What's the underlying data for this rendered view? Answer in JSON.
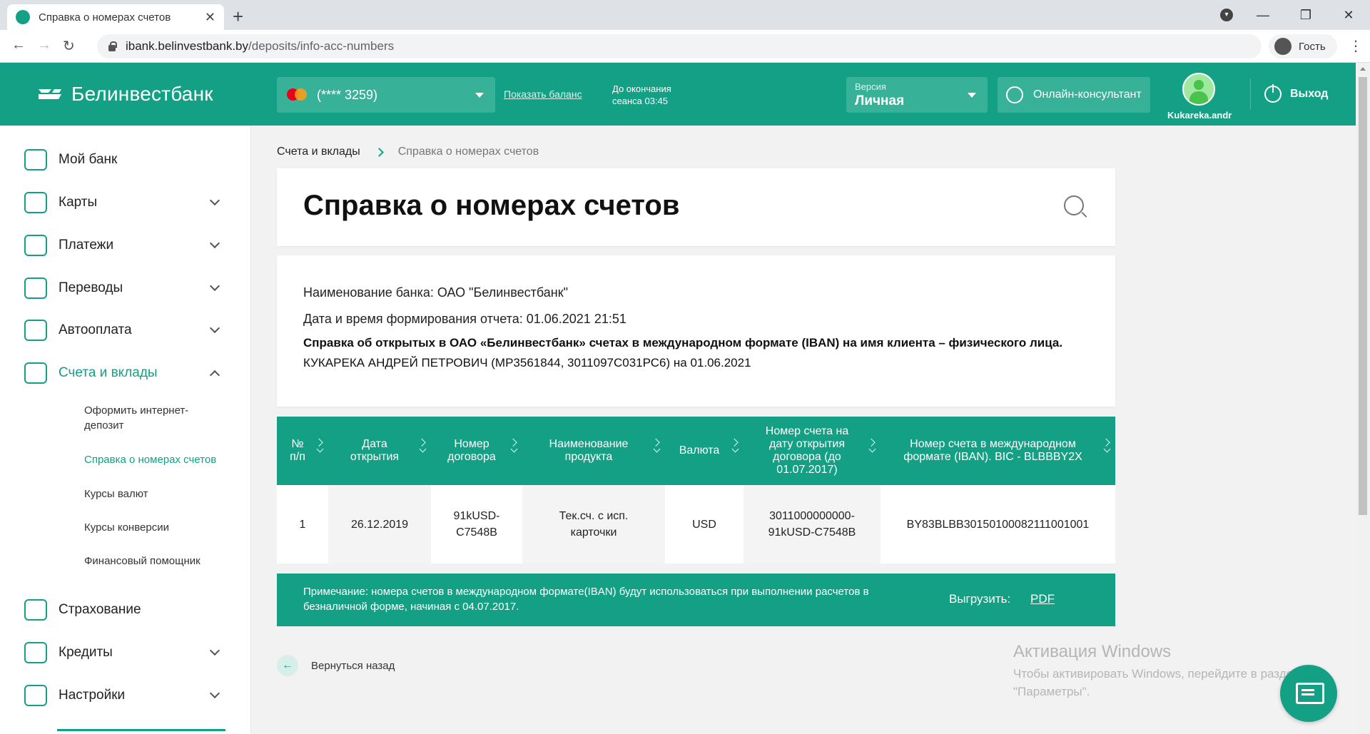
{
  "browser": {
    "tab_title": "Справка о номерах счетов",
    "url_host": "ibank.belinvestbank.by",
    "url_path": "/deposits/info-acc-numbers",
    "profile": "Гость"
  },
  "header": {
    "logo": "Белинвестбанк",
    "card": "(**** 3259)",
    "show_balance": "Показать баланс",
    "session_line1": "До окончания",
    "session_line2": "сеанса 03:45",
    "version_label": "Версия",
    "version_value": "Личная",
    "consultant": "Онлайн-консультант",
    "user": "Kukareka.andr",
    "logout": "Выход",
    "accent": "#13a085"
  },
  "sidebar": {
    "items": [
      {
        "label": "Мой банк",
        "icon": "bank-icon"
      },
      {
        "label": "Карты",
        "icon": "card-icon"
      },
      {
        "label": "Платежи",
        "icon": "payment-tag-icon"
      },
      {
        "label": "Переводы",
        "icon": "transfer-icon"
      },
      {
        "label": "Автооплата",
        "icon": "autopay-icon"
      },
      {
        "label": "Счета и вклады",
        "icon": "safe-icon"
      },
      {
        "label": "Страхование",
        "icon": "shield-icon"
      },
      {
        "label": "Кредиты",
        "icon": "money-icon"
      },
      {
        "label": "Настройки",
        "icon": "gear-icon"
      }
    ],
    "subitems": [
      "Оформить интернет-депозит",
      "Справка о номерах счетов",
      "Курсы валют",
      "Курсы конверсии",
      "Финансовый помощник"
    ]
  },
  "breadcrumb": {
    "parent": "Счета и вклады",
    "current": "Справка о номерах счетов"
  },
  "page": {
    "title": "Справка о номерах счетов"
  },
  "info": {
    "bank": "Наименование банка: ОАО \"Белинвестбанк\"",
    "datetime": "Дата и время формирования отчета: 01.06.2021 21:51",
    "statement": "Справка об открытых в ОАО «Белинвестбанк» счетах в международном формате (IBAN) на имя клиента – физического лица.",
    "client": "КУКАРЕКА АНДРЕЙ ПЕТРОВИЧ (МР3561844, 3011097С031РС6) на 01.06.2021"
  },
  "table": {
    "headers": [
      "№ п/п",
      "Дата открытия",
      "Номер договора",
      "Наименование продукта",
      "Валюта",
      "Номер счета на дату открытия договора (до 01.07.2017)",
      "Номер счета в международном формате (IBAN). BIC - BLBBBY2X"
    ],
    "rows": [
      [
        "1",
        "26.12.2019",
        "91kUSD-C7548B",
        "Тек.сч. с исп. карточки",
        "USD",
        "3011000000000-91kUSD-C7548B",
        "BY83BLBB30150100082111001001"
      ]
    ]
  },
  "note": {
    "text": "Примечание: номера счетов в международном формате(IBAN) будут использоваться при выполнении расчетов в безналичной форме, начиная с 04.07.2017.",
    "export_label": "Выгрузить:",
    "pdf": "PDF"
  },
  "back": "Вернуться назад",
  "watermark": {
    "title": "Активация Windows",
    "text": "Чтобы активировать Windows, перейдите в раздел \"Параметры\"."
  }
}
